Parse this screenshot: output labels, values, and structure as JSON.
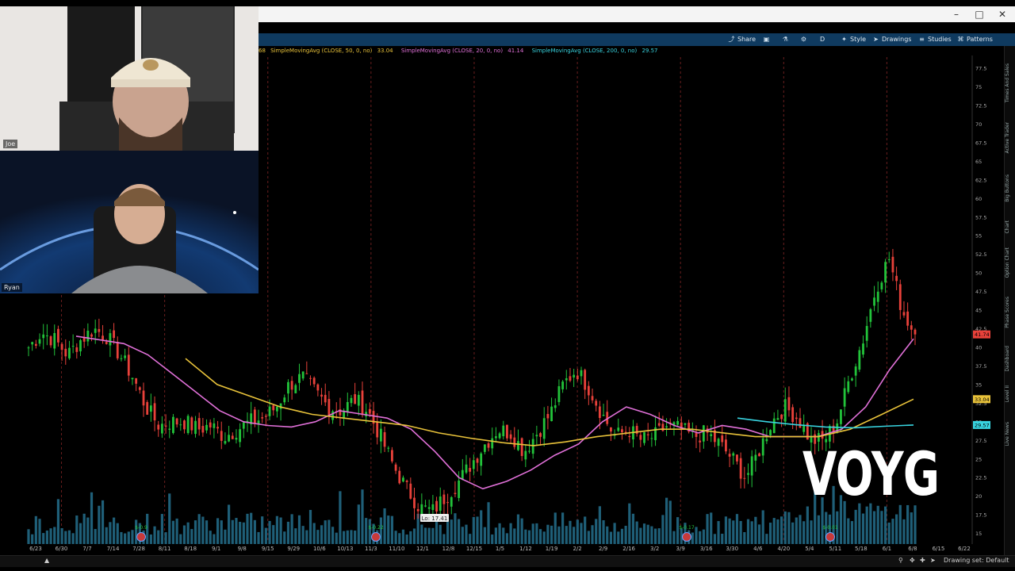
{
  "toolbar": {
    "items": [
      {
        "label": "Share",
        "icon": "share-icon"
      },
      {
        "label": "",
        "icon": "screen-icon"
      },
      {
        "label": "",
        "icon": "flask-icon"
      },
      {
        "label": "",
        "icon": "gear-icon"
      },
      {
        "label": "D",
        "icon": ""
      },
      {
        "label": "Style",
        "icon": "style-icon"
      },
      {
        "label": "Drawings",
        "icon": "cursor-icon"
      },
      {
        "label": "Studies",
        "icon": "studies-icon"
      },
      {
        "label": "Patterns",
        "icon": "patterns-icon"
      }
    ]
  },
  "studies": [
    {
      "prefix": "68",
      "label": "SimpleMovingAvg (CLOSE, 50, 0, no)",
      "value": "33.04",
      "color": "#e8c23a"
    },
    {
      "label": "SimpleMovingAvg (CLOSE, 20, 0, no)",
      "value": "41.14",
      "color": "#e070d8"
    },
    {
      "label": "SimpleMovingAvg (CLOSE, 200, 0, no)",
      "value": "29.57",
      "color": "#38d4e0"
    }
  ],
  "webcams": [
    {
      "name": "Joe"
    },
    {
      "name": "Ryan"
    }
  ],
  "ticker": "VOYG",
  "rail_tabs": [
    "Times And Sales",
    "Active Trader",
    "Big Buttons",
    "Chart",
    "Option Chart",
    "Phase Scores",
    "Dashboard",
    "Level II",
    "Live News"
  ],
  "status": {
    "drawing_set": "Drawing set: Default"
  },
  "colors": {
    "up": "#22c33a",
    "down": "#e8413a",
    "sma50": "#e8c23a",
    "sma20": "#e070d8",
    "sma200": "#38d4e0",
    "volume": "#1f5f78"
  },
  "chart_data": {
    "type": "candlestick",
    "x_ticks": [
      "6/23",
      "6/30",
      "7/7",
      "7/14",
      "7/28",
      "8/11",
      "8/18",
      "9/1",
      "9/8",
      "9/15",
      "9/29",
      "10/6",
      "10/13",
      "11/3",
      "11/10",
      "12/1",
      "12/8",
      "12/15",
      "1/5",
      "1/12",
      "1/19",
      "2/2",
      "2/9",
      "2/16",
      "3/2",
      "3/9",
      "3/16",
      "3/30",
      "4/6",
      "4/20",
      "5/4",
      "5/11",
      "5/18",
      "6/1",
      "6/8",
      "6/15",
      "6/22"
    ],
    "y_ticks": [
      15,
      17.5,
      20,
      22.5,
      25,
      27.5,
      30,
      32.5,
      35,
      37.5,
      40,
      42.5,
      45,
      47.5,
      50,
      52.5,
      55,
      57.5,
      60,
      62.5,
      65,
      67.5,
      70,
      72.5,
      75,
      77.5
    ],
    "ylim": [
      14,
      79
    ],
    "price_series": [
      40,
      42,
      41,
      39,
      41,
      42.5,
      41.5,
      39,
      36,
      32,
      29.5,
      30,
      30,
      29,
      29.5,
      28,
      29,
      30,
      30.5,
      32,
      35,
      36,
      34,
      32,
      31.5,
      33,
      31.5,
      28,
      24,
      21,
      18.5,
      18,
      20,
      22,
      24.5,
      27,
      29,
      28.5,
      26,
      28.5,
      31,
      35,
      37,
      34.5,
      31,
      28,
      29,
      27.5,
      28,
      29.5,
      29,
      28,
      28.5,
      27,
      25,
      22.5,
      26,
      30,
      32,
      30.5,
      27.5,
      27.5,
      30,
      36,
      41,
      48,
      52,
      45,
      41.7
    ],
    "low_label": "Lo: 17.41",
    "series": [
      {
        "values": [
          41.5,
          41,
          40.5,
          39,
          36.5,
          34,
          31.5,
          30,
          29.5,
          29.3,
          30,
          31.5,
          31,
          30.5,
          29,
          26,
          22.5,
          21,
          22,
          23.5,
          25.5,
          27,
          30,
          32,
          31,
          29.5,
          28.5,
          29.5,
          29,
          28,
          28,
          28,
          29,
          32,
          37,
          41.14
        ]
      },
      {
        "values": [
          38.5,
          35,
          33.5,
          32,
          31,
          30.5,
          30,
          29.5,
          28.5,
          27.8,
          27.2,
          26.8,
          27.3,
          28,
          28.5,
          29,
          29,
          28.5,
          28,
          28,
          28,
          29,
          31,
          33.04
        ]
      },
      {
        "values": [
          30.5,
          30,
          29.6,
          29.3,
          29.2,
          29.4,
          29.57
        ]
      }
    ],
    "price_tags": [
      {
        "value": 41.74,
        "label": "41.74",
        "color": "#e8413a"
      },
      {
        "value": 33.04,
        "label": "33.04",
        "color": "#e8c23a"
      },
      {
        "value": 29.57,
        "label": "29.57",
        "color": "#38d4e0"
      }
    ],
    "earnings_markers": 6,
    "dividend_labels": [
      "$-0.9",
      "$-0.22",
      "$-0.17",
      "$-0.01"
    ]
  }
}
